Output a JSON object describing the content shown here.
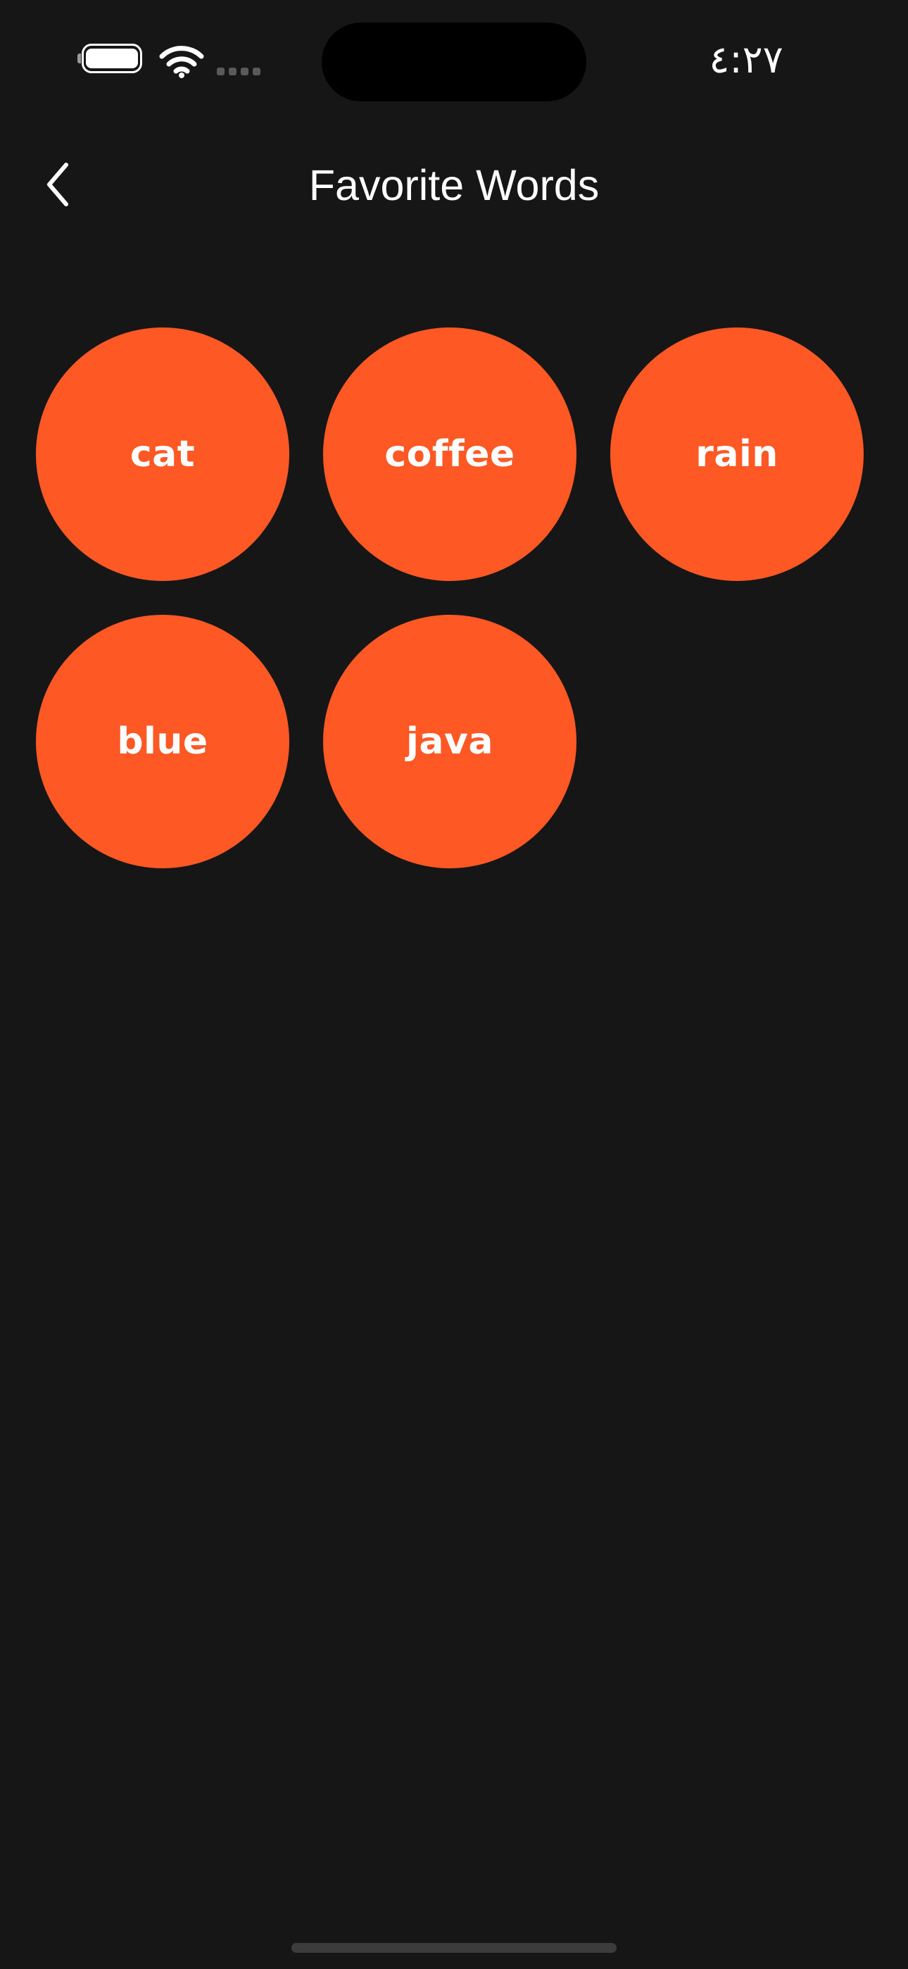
{
  "status_bar": {
    "time": "٤:٢٧",
    "battery_icon": "battery-full-icon",
    "wifi_icon": "wifi-icon",
    "signal_icon": "cellular-signal-icon"
  },
  "nav": {
    "title": "Favorite Words",
    "back_icon": "chevron-left-icon"
  },
  "words": [
    "cat",
    "coffee",
    "rain",
    "blue",
    "java"
  ],
  "colors": {
    "background": "#161616",
    "bubble": "#fe5925",
    "text": "#ffffff"
  }
}
